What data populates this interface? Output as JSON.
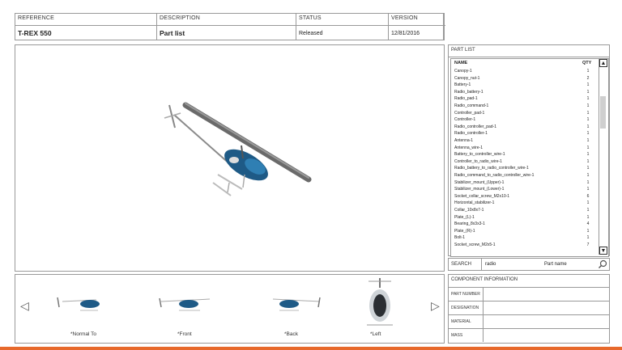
{
  "header": {
    "reference_label": "REFERENCE",
    "reference_value": "T-REX 550",
    "description_label": "DESCRIPTION",
    "description_value": "Part list",
    "status_label": "STATUS",
    "status_value": "Released",
    "version_label": "VERSION",
    "version_value": "12/81/2016"
  },
  "thumbnails": [
    {
      "caption": "*Normal To"
    },
    {
      "caption": "*Front"
    },
    {
      "caption": "*Back"
    },
    {
      "caption": "*Left"
    }
  ],
  "part_list": {
    "title": "PART LIST",
    "col_name": "NAME",
    "col_qty": "QTY",
    "rows": [
      {
        "name": "Canopy-1",
        "qty": "1"
      },
      {
        "name": "Canopy_nut-1",
        "qty": "2"
      },
      {
        "name": "Battery-1",
        "qty": "1"
      },
      {
        "name": "Radio_battery-1",
        "qty": "1"
      },
      {
        "name": "Radio_pad-1",
        "qty": "1"
      },
      {
        "name": "Radio_command-1",
        "qty": "1"
      },
      {
        "name": "Controller_pad-1",
        "qty": "1"
      },
      {
        "name": "Controller-1",
        "qty": "1"
      },
      {
        "name": "Radio_controller_pad-1",
        "qty": "1"
      },
      {
        "name": "Radio_controller-1",
        "qty": "1"
      },
      {
        "name": "Antenna-1",
        "qty": "1"
      },
      {
        "name": "Antenna_wire-1",
        "qty": "1"
      },
      {
        "name": "Battery_to_controller_wire-1",
        "qty": "1"
      },
      {
        "name": "Controller_to_radio_wire-1",
        "qty": "1"
      },
      {
        "name": "Radio_battery_to_radio_controller_wire-1",
        "qty": "1"
      },
      {
        "name": "Radio_command_to_radio_controller_wire-1",
        "qty": "1"
      },
      {
        "name": "Stabilizer_mount_(Upper)-1",
        "qty": "1"
      },
      {
        "name": "Stabilizer_mount_(Lower)-1",
        "qty": "1"
      },
      {
        "name": "Socket_collar_screw_M2x10-1",
        "qty": "6"
      },
      {
        "name": "Horizontal_stabilizer-1",
        "qty": "1"
      },
      {
        "name": "Collar_10x8x7-1",
        "qty": "1"
      },
      {
        "name": "Plate_(L)-1",
        "qty": "1"
      },
      {
        "name": "Bearing_8x3x3-1",
        "qty": "4"
      },
      {
        "name": "Plate_(R)-1",
        "qty": "1"
      },
      {
        "name": "Bolt-1",
        "qty": "1"
      },
      {
        "name": "Socket_screw_M2x5-1",
        "qty": "7"
      }
    ]
  },
  "search": {
    "label": "SEARCH",
    "value": "radio",
    "field": "Part name"
  },
  "component_info": {
    "title": "COMPONENT INFORMATION",
    "fields": [
      "PART NUMBER",
      "DESIGNATION",
      "MATERIAL",
      "MASS"
    ]
  },
  "colors": {
    "accent": "#e7692c",
    "heli_body": "#1e5a86",
    "blade": "#6a6a6a"
  }
}
